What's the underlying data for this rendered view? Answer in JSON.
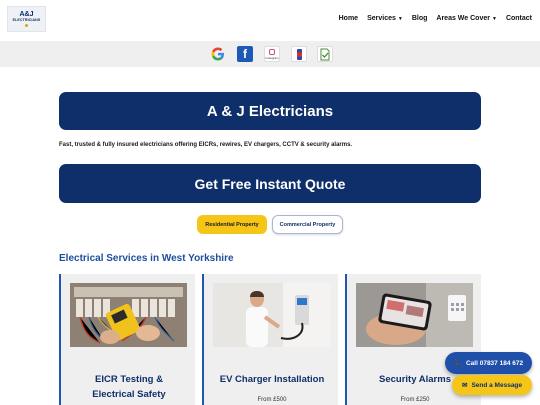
{
  "logo": {
    "top": "A&J",
    "bottom": "ELECTRICIANS"
  },
  "nav": {
    "home": "Home",
    "services": "Services",
    "blog": "Blog",
    "areas": "Areas We Cover",
    "contact": "Contact"
  },
  "reviews": {
    "facebook_letter": "f",
    "instagram_text": "Instagram"
  },
  "main": {
    "title": "A & J Electricians",
    "tagline": "Fast, trusted & fully insured electricians offering EICRs, rewires, EV chargers, CCTV & security alarms.",
    "quote_button": "Get Free Instant Quote",
    "residential": "Residential Property",
    "commercial": "Commercial Property",
    "section_heading": "Electrical Services in West Yorkshire"
  },
  "cards": [
    {
      "title_line1": "EICR Testing &",
      "title_line2": "Electrical Safety",
      "price": ""
    },
    {
      "title_line1": "EV Charger Installation",
      "title_line2": "",
      "price": "From £500"
    },
    {
      "title_line1": "Security Alarms",
      "title_line2": "",
      "price": "From £250"
    }
  ],
  "floating": {
    "call": "Call 07837 184 672",
    "message": "Send a Message"
  },
  "colors": {
    "navy": "#0f2f6b",
    "accent_yellow": "#f5c518",
    "heading_blue": "#1e4e9a"
  }
}
